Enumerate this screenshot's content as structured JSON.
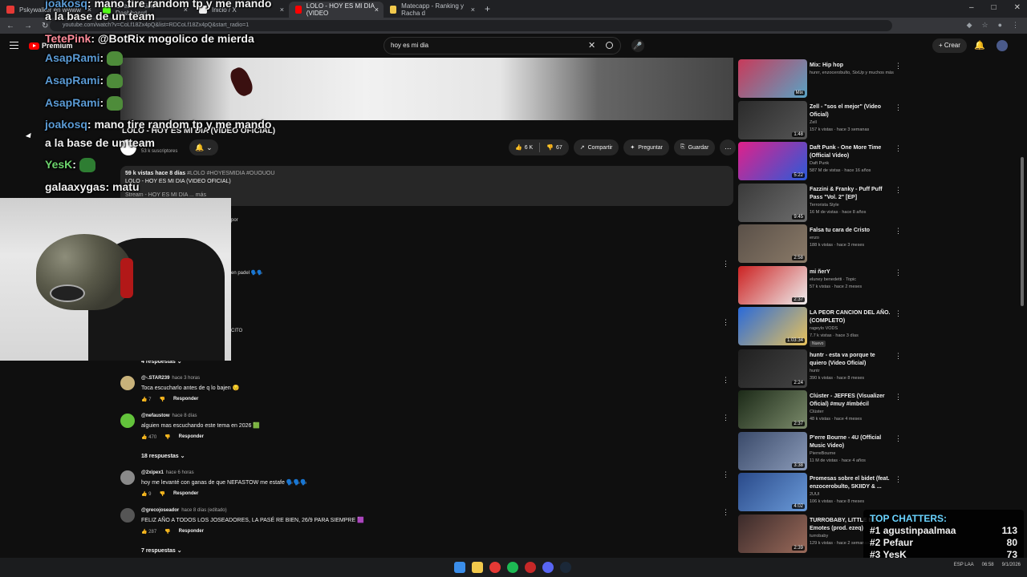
{
  "browser": {
    "tabs": [
      {
        "label": "Pskywalker en wwww",
        "color": "#e53935"
      },
      {
        "label": "Stream - Kick Dashboard",
        "color": "#53fc18"
      },
      {
        "label": "Inicio / X",
        "color": "#eeeeee"
      },
      {
        "label": "LOLO - HOY ES MI DIA (VIDEO",
        "color": "#ff0000"
      },
      {
        "label": "Matecapp - Ranking y Racha d",
        "color": "#f2c94c"
      }
    ],
    "url": "youtube.com/watch?v=CoLf18Zx4pQ&list=RDCoLf18Zx4pQ&start_radio=1"
  },
  "youtube": {
    "logo": "Premium",
    "search_query": "hoy es mi dia",
    "create_label": "Crear",
    "video": {
      "title": "LOLO - HOY ES MI DIA (VIDEO OFICIAL)",
      "subscribers": "53 k suscriptores",
      "likes": "6 K",
      "dislikes": "67",
      "share": "Compartir",
      "ask": "Preguntar",
      "save": "Guardar",
      "views_date": "59 k vistas  hace 8 días",
      "hashtags": "#LOLO #HOYESMIDIA #OUOUOU",
      "desc_line": "LOLO - HOY ES MI DIA (VIDEO OFICIAL)",
      "desc_more": "Stream - HOY ES MI DIA ... más"
    },
    "fragments": {
      "por": "por",
      "padel": "en padel 🗣️🗣️",
      "cito": "CITO"
    },
    "replies_1": "4 respuestas",
    "comments": [
      {
        "user": "@-.STAR239",
        "time": "hace 3 horas",
        "text": "Toca escucharlo antes de q lo bajen 😔",
        "likes": "7",
        "reply": "Responder",
        "color": "#c8b27a"
      },
      {
        "user": "@nefaustow",
        "time": "hace 8 días",
        "text": "alguien mas escuchando este tema en 2026 🟩",
        "likes": "470",
        "reply": "Responder",
        "color": "#63c33b"
      },
      {
        "user": "@2xipex1",
        "time": "hace 6 horas",
        "text": "hoy me levanté con ganas de que NEFASTOW me estafe 🗣️🗣️🗣️",
        "likes": "9",
        "reply": "Responder",
        "color": "#8a8a8a"
      },
      {
        "user": "@grecojoseador",
        "time": "hace 8 días (editado)",
        "text": "FELIZ AÑO A TODOS LOS JOSEADORES, LA PASÉ RE BIEN, 26/9 PARA SIEMPRE 🟪",
        "likes": "287",
        "reply": "Responder",
        "color": "#555555"
      }
    ],
    "replies_2": "18 respuestas",
    "replies_3": "7 respuestas",
    "sidebar": [
      {
        "title": "Mix: Hip hop",
        "channel": "hunrr, enzocerobulto, SixUp y muchos más",
        "views": "",
        "dur": "Mix",
        "c1": "#c83a5a",
        "c2": "#59a3c5"
      },
      {
        "title": "Zell - \"sos el mejor\" (Video Oficial)",
        "channel": "Zell",
        "views": "157 k vistas · hace 3 semanas",
        "dur": "1:48",
        "c1": "#2b2b2b",
        "c2": "#555"
      },
      {
        "title": "Daft Punk - One More Time (Official Video)",
        "channel": "Daft Punk",
        "views": "587 M de vistas · hace 16 años",
        "dur": "5:22",
        "c1": "#e0208a",
        "c2": "#2b5bd9"
      },
      {
        "title": "Fazzini & Franky - Puff Puff Pass \"Vol. 2\" [EP]",
        "channel": "Terrorista Style",
        "views": "16 M de vistas · hace 8 años",
        "dur": "9:45",
        "c1": "#3a3a3a",
        "c2": "#6d6d6d"
      },
      {
        "title": "Falsa tu cara de Cristo",
        "channel": "enzo",
        "views": "188 k vistas · hace 3 meses",
        "dur": "2:58",
        "c1": "#5a5048",
        "c2": "#8a7a68"
      },
      {
        "title": "mi ñerY",
        "channel": "eluney benedetti · Topic",
        "views": "57 k vistas · hace 2 meses",
        "dur": "2:37",
        "c1": "#c22",
        "c2": "#eee"
      },
      {
        "title": "LA PEOR CANCION DEL AÑO. (COMPLETO)",
        "channel": "rageylo VODS",
        "views": "7.7 k vistas · hace 3 días",
        "dur": "1:03:34",
        "c1": "#2a6ad9",
        "c2": "#e8c25a"
      },
      {
        "title": "huntr - esta va porque te quiero (Video Oficial)",
        "channel": "huntr",
        "views": "390 k vistas · hace 8 meses",
        "dur": "2:24",
        "c1": "#202020",
        "c2": "#444"
      },
      {
        "title": "Clúster - JEFFES (Visualizer Oficial) #muy #imbécil",
        "channel": "Clúster",
        "views": "48 k vistas · hace 4 meses",
        "dur": "2:37",
        "c1": "#1c2a18",
        "c2": "#7a8a6a"
      },
      {
        "title": "P'erre Bourne - 4U (Official Music Video)",
        "channel": "PierreBourne",
        "views": "11 M de vistas · hace 4 años",
        "dur": "3:38",
        "c1": "#3a4a6a",
        "c2": "#8a9ab8"
      },
      {
        "title": "Promesas sobre el bidet (feat. enzocerobulto, SKIIDY & ...",
        "channel": "2UUI",
        "views": "106 k vistas · hace 8 meses",
        "dur": "4:02",
        "c1": "#2a4a8a",
        "c2": "#6a9ad8"
      },
      {
        "title": "TURROBABY, LITTLE BO... Emotes (prod. ezeq)",
        "channel": "turrobaby",
        "views": "129 k vistas · hace 2 semanas",
        "dur": "2:39",
        "c1": "#3a2a2a",
        "c2": "#9a6a5a"
      }
    ],
    "badge_new": "Nuevo"
  },
  "chat": [
    {
      "user": "joakosq",
      "text": "mano tire random tp y me mando",
      "cont": "a la base de un team"
    },
    {
      "user": "TetePink",
      "text": "@BotRix mogolico de mierda"
    },
    {
      "user": "AsapRami",
      "text": ""
    },
    {
      "user": "AsapRami",
      "text": ""
    },
    {
      "user": "AsapRami",
      "text": ""
    },
    {
      "user": "joakosq",
      "text": "mano tire random tp y me mando",
      "cont": "a la base de un team"
    },
    {
      "user": "YesK",
      "text": ""
    },
    {
      "user": "galaaxygas",
      "text": "matu"
    }
  ],
  "top_chatters": {
    "title": "TOP CHATTERS:",
    "rows": [
      {
        "rank": "#1",
        "name": "agustinpaalmaa",
        "count": "113"
      },
      {
        "rank": "#2",
        "name": "Pefaur",
        "count": "80"
      },
      {
        "rank": "#3",
        "name": "YesK",
        "count": "73"
      }
    ]
  },
  "taskbar": {
    "lang": "ESP LAA",
    "time": "06:58",
    "date": "9/1/2026"
  }
}
